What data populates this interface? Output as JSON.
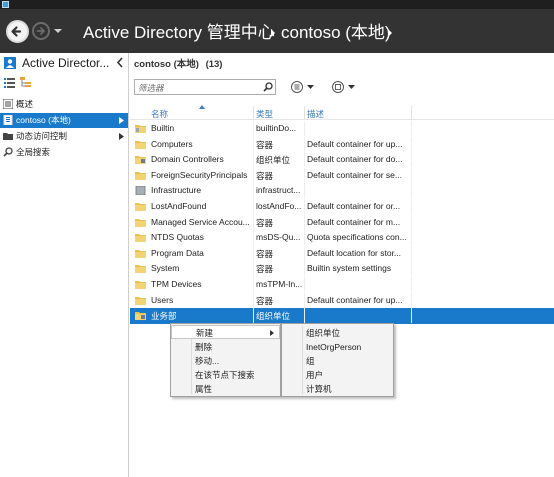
{
  "header": {
    "app_title": "Active Directory 管理中心",
    "domain_crumb": "contoso (本地)"
  },
  "left_pane": {
    "title": "Active Director...",
    "items": [
      {
        "label": "概述",
        "icon": "overview-icon"
      },
      {
        "label": "contoso (本地)",
        "icon": "domain-icon",
        "selected": true
      },
      {
        "label": "动态访问控制",
        "icon": "folder-icon"
      },
      {
        "label": "全局搜索",
        "icon": "search-icon"
      }
    ]
  },
  "main": {
    "title": "contoso (本地)",
    "count": "(13)",
    "filter_placeholder": "筛选器",
    "columns": {
      "name": "名称",
      "type": "类型",
      "desc": "描述"
    },
    "rows": [
      {
        "name": "Builtin",
        "type": "builtinDo...",
        "desc": "",
        "icon": "builtin-icon"
      },
      {
        "name": "Computers",
        "type": "容器",
        "desc": "Default container for up...",
        "icon": "folder-icon"
      },
      {
        "name": "Domain Controllers",
        "type": "组织单位",
        "desc": "Default container for do...",
        "icon": "ou-icon"
      },
      {
        "name": "ForeignSecurityPrincipals",
        "type": "容器",
        "desc": "Default container for se...",
        "icon": "folder-icon"
      },
      {
        "name": "Infrastructure",
        "type": "infrastruct...",
        "desc": "",
        "icon": "infra-icon"
      },
      {
        "name": "LostAndFound",
        "type": "lostAndFo...",
        "desc": "Default container for or...",
        "icon": "folder-icon"
      },
      {
        "name": "Managed Service Accou...",
        "type": "容器",
        "desc": "Default container for m...",
        "icon": "folder-icon"
      },
      {
        "name": "NTDS Quotas",
        "type": "msDS-Qu...",
        "desc": "Quota specifications con...",
        "icon": "folder-icon"
      },
      {
        "name": "Program Data",
        "type": "容器",
        "desc": "Default location for stor...",
        "icon": "folder-icon"
      },
      {
        "name": "System",
        "type": "容器",
        "desc": "Builtin system settings",
        "icon": "folder-icon"
      },
      {
        "name": "TPM Devices",
        "type": "msTPM-In...",
        "desc": "",
        "icon": "folder-icon"
      },
      {
        "name": "Users",
        "type": "容器",
        "desc": "Default container for up...",
        "icon": "folder-icon"
      },
      {
        "name": "业务部",
        "type": "组织单位",
        "desc": "",
        "icon": "ou-icon",
        "selected": true
      }
    ]
  },
  "context_menu": {
    "items": [
      "新建",
      "删除",
      "移动...",
      "在该节点下搜索",
      "属性"
    ],
    "highlighted": "新建"
  },
  "submenu": {
    "items": [
      "组织单位",
      "InetOrgPerson",
      "组",
      "用户",
      "计算机"
    ]
  },
  "colors": {
    "header_bg": "#333333",
    "selection": "#1979ca",
    "column_header": "#3b7bbf",
    "folder": "#e8c14e"
  }
}
